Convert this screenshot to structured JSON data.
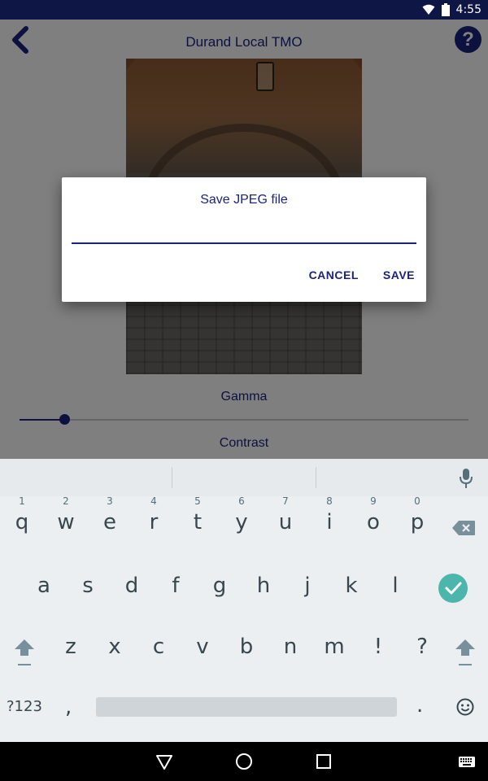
{
  "status_bar": {
    "time": "4:55",
    "icons": [
      "wifi-icon",
      "battery-icon"
    ],
    "background": "#0d1645"
  },
  "app": {
    "title": "Durand Local TMO",
    "back_icon": "back-arrow-icon",
    "help_label": "?",
    "gamma_label": "Gamma",
    "gamma_value_fraction": 0.1,
    "contrast_label": "Contrast",
    "accent": "#1a237e"
  },
  "dialog": {
    "title": "Save JPEG file",
    "input_value": "",
    "cancel_label": "CANCEL",
    "save_label": "SAVE"
  },
  "keyboard": {
    "rows": [
      [
        {
          "key": "q",
          "hint": "1"
        },
        {
          "key": "w",
          "hint": "2"
        },
        {
          "key": "e",
          "hint": "3"
        },
        {
          "key": "r",
          "hint": "4"
        },
        {
          "key": "t",
          "hint": "5"
        },
        {
          "key": "y",
          "hint": "6"
        },
        {
          "key": "u",
          "hint": "7"
        },
        {
          "key": "i",
          "hint": "8"
        },
        {
          "key": "o",
          "hint": "9"
        },
        {
          "key": "p",
          "hint": "0"
        }
      ],
      [
        "a",
        "s",
        "d",
        "f",
        "g",
        "h",
        "j",
        "k",
        "l"
      ],
      [
        "z",
        "x",
        "c",
        "v",
        "b",
        "n",
        "m",
        "!",
        "?"
      ]
    ],
    "symbols_label": "?123",
    "comma_label": ",",
    "period_label": ".",
    "enter_color": "#4db6ac",
    "special_icons": [
      "microphone-icon",
      "backspace-icon",
      "check-icon",
      "shift-icon",
      "emoji-icon"
    ]
  },
  "nav_bar": {
    "icons": [
      "back-triangle-icon",
      "home-circle-icon",
      "recents-square-icon",
      "keyboard-switch-icon"
    ]
  }
}
